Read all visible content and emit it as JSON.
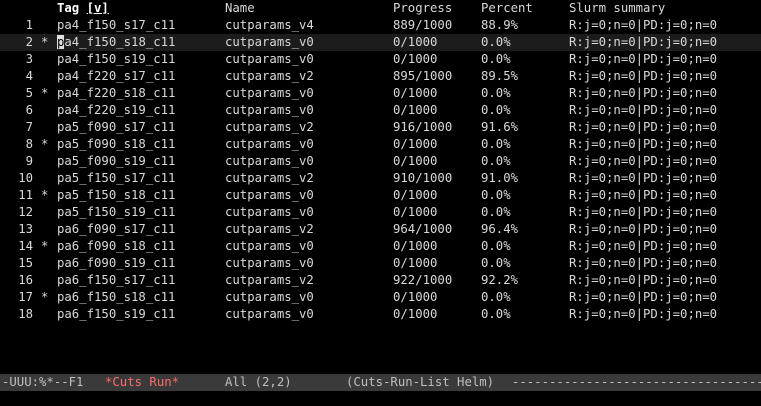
{
  "header": {
    "tag": "Tag",
    "sort_indicator": "[v]",
    "name": "Name",
    "progress": "Progress",
    "percent": "Percent",
    "slurm": "Slurm summary"
  },
  "rows": [
    {
      "num": "1",
      "mark": "",
      "tag": "pa4_f150_s17_c11",
      "name": "cutparams_v4",
      "progress": "889/1000",
      "percent": "88.9%",
      "slurm": "R:j=0;n=0|PD:j=0;n=0"
    },
    {
      "num": "2",
      "mark": "*",
      "tag": "pa4_f150_s18_c11",
      "name": "cutparams_v0",
      "progress": "0/1000",
      "percent": "0.0%",
      "slurm": "R:j=0;n=0|PD:j=0;n=0"
    },
    {
      "num": "3",
      "mark": "",
      "tag": "pa4_f150_s19_c11",
      "name": "cutparams_v0",
      "progress": "0/1000",
      "percent": "0.0%",
      "slurm": "R:j=0;n=0|PD:j=0;n=0"
    },
    {
      "num": "4",
      "mark": "",
      "tag": "pa4_f220_s17_c11",
      "name": "cutparams_v2",
      "progress": "895/1000",
      "percent": "89.5%",
      "slurm": "R:j=0;n=0|PD:j=0;n=0"
    },
    {
      "num": "5",
      "mark": "*",
      "tag": "pa4_f220_s18_c11",
      "name": "cutparams_v0",
      "progress": "0/1000",
      "percent": "0.0%",
      "slurm": "R:j=0;n=0|PD:j=0;n=0"
    },
    {
      "num": "6",
      "mark": "",
      "tag": "pa4_f220_s19_c11",
      "name": "cutparams_v0",
      "progress": "0/1000",
      "percent": "0.0%",
      "slurm": "R:j=0;n=0|PD:j=0;n=0"
    },
    {
      "num": "7",
      "mark": "",
      "tag": "pa5_f090_s17_c11",
      "name": "cutparams_v2",
      "progress": "916/1000",
      "percent": "91.6%",
      "slurm": "R:j=0;n=0|PD:j=0;n=0"
    },
    {
      "num": "8",
      "mark": "*",
      "tag": "pa5_f090_s18_c11",
      "name": "cutparams_v0",
      "progress": "0/1000",
      "percent": "0.0%",
      "slurm": "R:j=0;n=0|PD:j=0;n=0"
    },
    {
      "num": "9",
      "mark": "",
      "tag": "pa5_f090_s19_c11",
      "name": "cutparams_v0",
      "progress": "0/1000",
      "percent": "0.0%",
      "slurm": "R:j=0;n=0|PD:j=0;n=0"
    },
    {
      "num": "10",
      "mark": "",
      "tag": "pa5_f150_s17_c11",
      "name": "cutparams_v2",
      "progress": "910/1000",
      "percent": "91.0%",
      "slurm": "R:j=0;n=0|PD:j=0;n=0"
    },
    {
      "num": "11",
      "mark": "*",
      "tag": "pa5_f150_s18_c11",
      "name": "cutparams_v0",
      "progress": "0/1000",
      "percent": "0.0%",
      "slurm": "R:j=0;n=0|PD:j=0;n=0"
    },
    {
      "num": "12",
      "mark": "",
      "tag": "pa5_f150_s19_c11",
      "name": "cutparams_v0",
      "progress": "0/1000",
      "percent": "0.0%",
      "slurm": "R:j=0;n=0|PD:j=0;n=0"
    },
    {
      "num": "13",
      "mark": "",
      "tag": "pa6_f090_s17_c11",
      "name": "cutparams_v2",
      "progress": "964/1000",
      "percent": "96.4%",
      "slurm": "R:j=0;n=0|PD:j=0;n=0"
    },
    {
      "num": "14",
      "mark": "*",
      "tag": "pa6_f090_s18_c11",
      "name": "cutparams_v0",
      "progress": "0/1000",
      "percent": "0.0%",
      "slurm": "R:j=0;n=0|PD:j=0;n=0"
    },
    {
      "num": "15",
      "mark": "",
      "tag": "pa6_f090_s19_c11",
      "name": "cutparams_v0",
      "progress": "0/1000",
      "percent": "0.0%",
      "slurm": "R:j=0;n=0|PD:j=0;n=0"
    },
    {
      "num": "16",
      "mark": "",
      "tag": "pa6_f150_s17_c11",
      "name": "cutparams_v2",
      "progress": "922/1000",
      "percent": "92.2%",
      "slurm": "R:j=0;n=0|PD:j=0;n=0"
    },
    {
      "num": "17",
      "mark": "*",
      "tag": "pa6_f150_s18_c11",
      "name": "cutparams_v0",
      "progress": "0/1000",
      "percent": "0.0%",
      "slurm": "R:j=0;n=0|PD:j=0;n=0"
    },
    {
      "num": "18",
      "mark": "",
      "tag": "pa6_f150_s19_c11",
      "name": "cutparams_v0",
      "progress": "0/1000",
      "percent": "0.0%",
      "slurm": "R:j=0;n=0|PD:j=0;n=0"
    }
  ],
  "current_row": 2,
  "mode_line": {
    "state": "-UUU:%*--F1",
    "buffer": "*Cuts Run*",
    "position": "All (2,2)",
    "mode": "(Cuts-Run-List Helm)",
    "filler": "------------------------------------------------------------"
  },
  "colors": {
    "background": "#000000",
    "foreground": "#d9d9d9",
    "mode_line_bg": "#3a3a3a",
    "buffer_name": "#ff6b6b",
    "cursor": "#e0e0e0"
  }
}
